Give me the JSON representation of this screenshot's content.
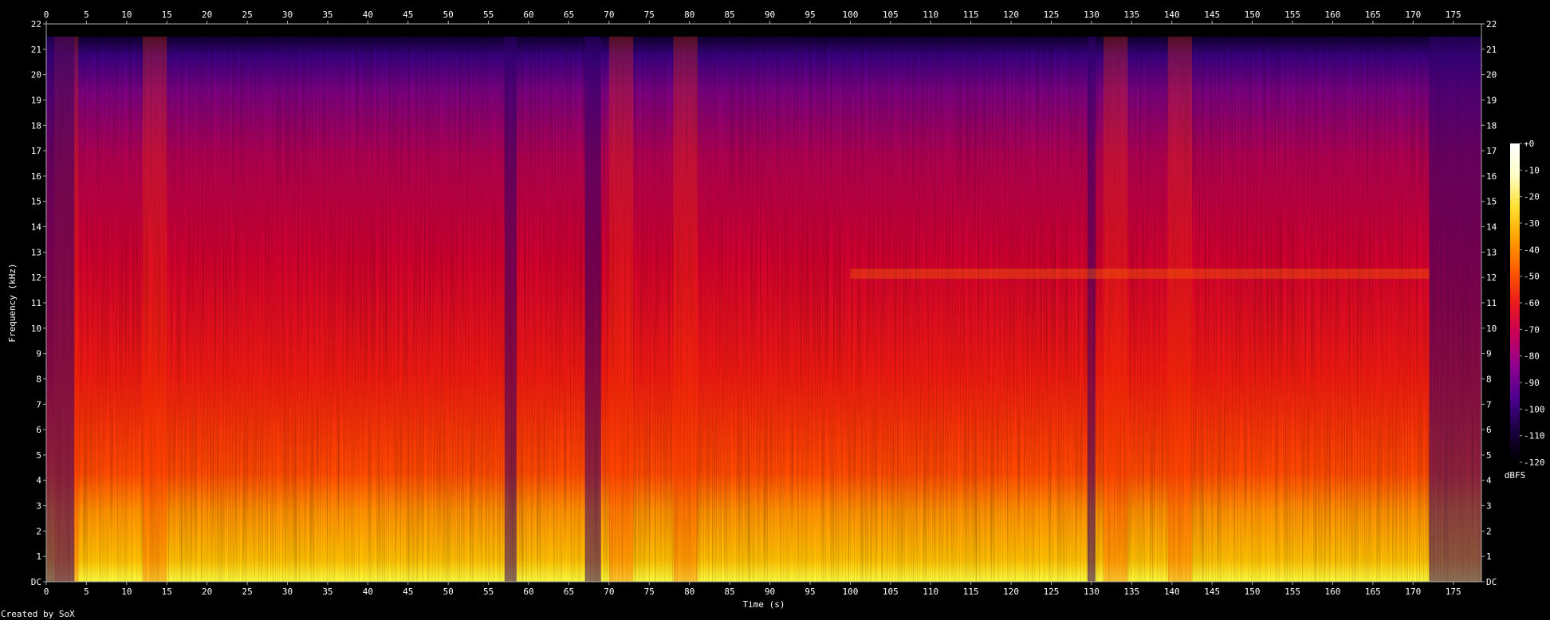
{
  "chart_data": {
    "type": "heatmap",
    "title": "",
    "xlabel": "Time (s)",
    "ylabel": "Frequency (kHz)",
    "xlim": [
      0,
      178.5
    ],
    "ylim": [
      0,
      22
    ],
    "x_ticks": [
      0,
      5,
      10,
      15,
      20,
      25,
      30,
      35,
      40,
      45,
      50,
      55,
      60,
      65,
      70,
      75,
      80,
      85,
      90,
      95,
      100,
      105,
      110,
      115,
      120,
      125,
      130,
      135,
      140,
      145,
      150,
      155,
      160,
      165,
      170,
      175
    ],
    "x_tick_labels": [
      "0",
      "5",
      "10",
      "15",
      "20",
      "25",
      "30",
      "35",
      "40",
      "45",
      "50",
      "55",
      "60",
      "65",
      "70",
      "75",
      "80",
      "85",
      "90",
      "95",
      "100",
      "105",
      "110",
      "115",
      "120",
      "125",
      "130",
      "135",
      "140",
      "145",
      "150",
      "155",
      "160",
      "165",
      "170",
      "175"
    ],
    "y_ticks": [
      0,
      1,
      2,
      3,
      4,
      5,
      6,
      7,
      8,
      9,
      10,
      11,
      12,
      13,
      14,
      15,
      16,
      17,
      18,
      19,
      20,
      21,
      22
    ],
    "y_tick_labels": [
      "DC",
      "1",
      "2",
      "3",
      "4",
      "5",
      "6",
      "7",
      "8",
      "9",
      "10",
      "11",
      "12",
      "13",
      "14",
      "15",
      "16",
      "17",
      "18",
      "19",
      "20",
      "21",
      "22"
    ],
    "colorbar": {
      "label": "dBFS",
      "range": [
        -120,
        0
      ],
      "ticks": [
        0,
        -10,
        -20,
        -30,
        -40,
        -50,
        -60,
        -70,
        -80,
        -90,
        -100,
        -110,
        -120
      ],
      "tick_labels": [
        "+0",
        "-10",
        "-20",
        "-30",
        "-40",
        "-50",
        "-60",
        "-70",
        "-80",
        "-90",
        "-100",
        "-110",
        "-120"
      ],
      "colors": [
        "#000000",
        "#1a0040",
        "#4a0090",
        "#8e0090",
        "#c8005a",
        "#ea1a1a",
        "#ff5a00",
        "#ffa000",
        "#ffe030",
        "#ffffc8",
        "#ffffff"
      ]
    },
    "content_cutoff_khz": 21.5,
    "quiet_segments_s": [
      [
        0,
        3.5
      ],
      [
        57,
        58.5
      ],
      [
        67,
        69
      ],
      [
        129.5,
        130.5
      ],
      [
        172,
        178.5
      ]
    ],
    "bright_bursts_s": [
      [
        1,
        4
      ],
      [
        12,
        15
      ],
      [
        70,
        73
      ],
      [
        78,
        81
      ],
      [
        131.5,
        134.5
      ],
      [
        139.5,
        142.5
      ]
    ],
    "band_12khz_segment_s": [
      100,
      172
    ]
  },
  "footer": {
    "credit": "Created by SoX"
  }
}
